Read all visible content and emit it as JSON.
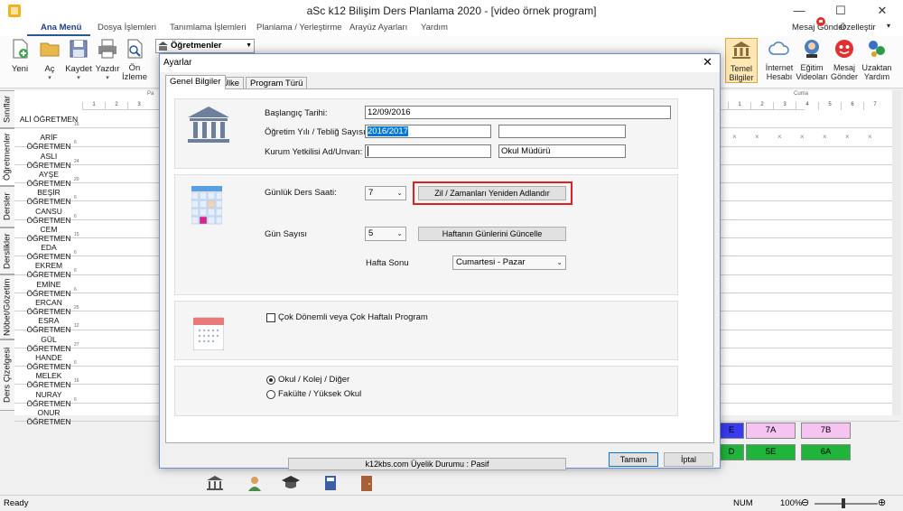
{
  "window": {
    "title": "aSc k12 Bilişim Ders Planlama 2020  - [video örnek program]",
    "minimize": "—",
    "maximize": "☐",
    "close": "✕"
  },
  "menu": {
    "tabs": [
      "Ana Menü",
      "Dosya İşlemleri",
      "Tanımlama İşlemleri",
      "Planlama / Yerleştirme",
      "Arayüz Ayarları",
      "Yardım"
    ]
  },
  "ribbon": {
    "yeni": "Yeni",
    "ac": "Aç",
    "kaydet": "Kaydet",
    "yazdir": "Yazdır",
    "on_izleme_1": "Ön",
    "on_izleme_2": "İzleme",
    "combo": "Öğretmenler",
    "temel_1": "Temel",
    "temel_2": "Bilgiler",
    "internet_1": "İnternet",
    "internet_2": "Hesabı",
    "egitim_1": "Eğitim",
    "egitim_2": "Videoları",
    "mesaj_1": "Mesaj",
    "mesaj_2": "Gönder",
    "uzaktan_1": "Uzaktan",
    "uzaktan_2": "Yardım",
    "mesaj_gonder": "Mesaj Gönder",
    "ozellestir": "Özelleştir"
  },
  "vtabs": [
    "Sınıflar",
    "Öğretmenler",
    "Dersler",
    "Derslikler",
    "Nöbet/Gözetim",
    "Ders Çizelgesi"
  ],
  "grid": {
    "day_left": "Pa",
    "day_right": "Cuma",
    "periods_left": [
      "1",
      "2",
      "3"
    ],
    "periods_right": [
      "1",
      "2",
      "3",
      "4",
      "5",
      "6",
      "7"
    ],
    "teachers": [
      {
        "name": "ALİ ÖĞRETMEN",
        "count": "16"
      },
      {
        "name": "ARİF ÖĞRETMEN",
        "count": "6"
      },
      {
        "name": "ASLI ÖĞRETMEN",
        "count": "24"
      },
      {
        "name": "AYŞE ÖĞRETMEN",
        "count": "20"
      },
      {
        "name": "BEŞİR ÖĞRETMEN",
        "count": "6"
      },
      {
        "name": "CANSU ÖĞRETMEN",
        "count": "6"
      },
      {
        "name": "CEM ÖĞRETMEN",
        "count": "15"
      },
      {
        "name": "EDA ÖĞRETMEN",
        "count": "6"
      },
      {
        "name": "EKREM ÖĞRETMEN",
        "count": "6"
      },
      {
        "name": "EMİNE ÖĞRETMEN",
        "count": "6"
      },
      {
        "name": "ERCAN ÖĞRETMEN",
        "count": "25"
      },
      {
        "name": "ESRA ÖĞRETMEN",
        "count": "12"
      },
      {
        "name": "GÜL ÖĞRETMEN",
        "count": "27"
      },
      {
        "name": "HANDE ÖĞRETMEN",
        "count": "6"
      },
      {
        "name": "MELEK ÖĞRETMEN",
        "count": "16"
      },
      {
        "name": "NURAY ÖĞRETMEN",
        "count": "6"
      },
      {
        "name": "ONUR ÖĞRETMEN",
        "count": ""
      }
    ],
    "x_mark": "×"
  },
  "classes": {
    "a": "7A",
    "b": "7B",
    "c": "5E",
    "d": "6A",
    "e": "E",
    "f": "D"
  },
  "statusbar": {
    "ready": "Ready",
    "num": "NUM",
    "zoom": "100%"
  },
  "dialog": {
    "title": "Ayarlar",
    "close": "✕",
    "tabs": [
      "Genel Bilgiler",
      "Ülke",
      "Program Türü"
    ],
    "baslangic_label": "Başlangıç Tarihi:",
    "baslangic_value": "12/09/2016",
    "ogretim_label": "Öğretim Yılı / Tebliğ Sayısı:",
    "ogretim_value": "2016/2017",
    "kurum_label": "Kurum Yetkilisi Ad/Unvan:",
    "okul_muduru": "Okul Müdürü",
    "gunluk_label": "Günlük Ders Saati:",
    "gunluk_value": "7",
    "zil_button": "Zil / Zamanları Yeniden Adlandır",
    "gun_label": "Gün Sayısı",
    "gun_value": "5",
    "hafta_button": "Haftanın Günlerini Güncelle",
    "hafta_sonu_label": "Hafta Sonu",
    "hafta_sonu_value": "Cumartesi - Pazar",
    "cok_donemli": "Çok Dönemli veya Çok Haftalı Program",
    "radio_okul": "Okul / Kolej / Diğer",
    "radio_fakulte": "Fakülte / Yüksek Okul",
    "member_status": "k12kbs.com Üyelik Durumu : Pasif",
    "tamam": "Tamam",
    "iptal": "İptal"
  },
  "colors": {
    "accent": "#2b579a",
    "highlight": "#e02020",
    "selection": "#0078d7"
  }
}
